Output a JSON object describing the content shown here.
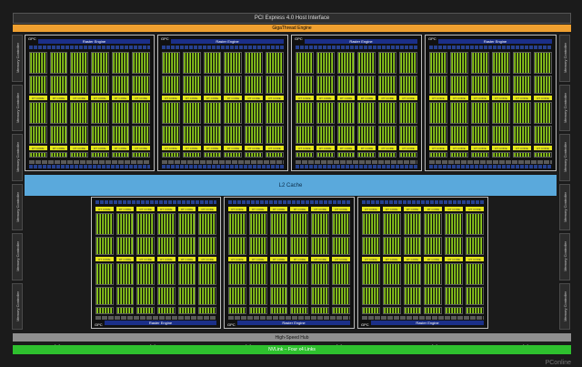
{
  "title_bar": "PCI Express 4.0 Host Interface",
  "giga_thread": "GigaThread Engine",
  "l2": "L2 Cache",
  "high_speed_hub": "High-Speed Hub",
  "nvlink": "NVLink – Four x4 Links",
  "watermark": "PConline",
  "memory_controller": "Memory Controller",
  "gpc_label": "GPC",
  "raster_engine": "Raster Engine",
  "rt_core": "RT CORE",
  "colors": {
    "l2": "#5aa9dc",
    "giga": "#f0a030",
    "nvlink": "#2ec02e",
    "sm_green": "#93d11c",
    "rt": "#e5e51a",
    "raster": "#1b2f88"
  }
}
